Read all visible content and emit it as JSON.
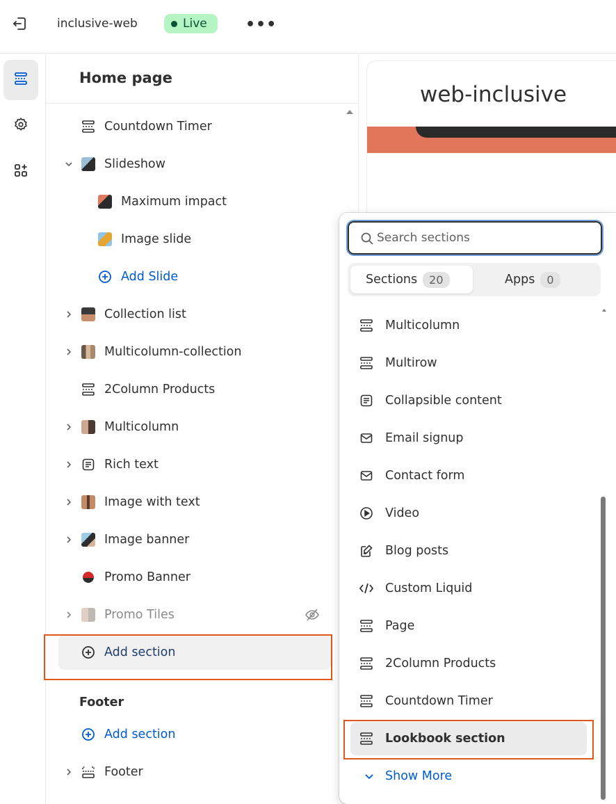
{
  "topbar": {
    "store_name": "inclusive-web",
    "status": "Live",
    "more": "•••",
    "exit_icon": "exit-icon"
  },
  "rail": {
    "items": [
      {
        "icon": "sections-icon",
        "active": true
      },
      {
        "icon": "settings-gear-icon",
        "active": false
      },
      {
        "icon": "apps-add-icon",
        "active": false
      }
    ]
  },
  "panel": {
    "title": "Home page",
    "sections": [
      {
        "label": "Countdown Timer",
        "icon": "section-icon"
      },
      {
        "label": "Slideshow",
        "icon": "image-thumb",
        "expanded": true
      },
      {
        "label": "Maximum impact",
        "icon": "image-thumb",
        "child": true
      },
      {
        "label": "Image slide",
        "icon": "image-thumb",
        "child": true
      },
      {
        "label": "Add Slide",
        "icon": "plus-circle-icon",
        "child": true,
        "link": true
      },
      {
        "label": "Collection list",
        "icon": "image-thumb"
      },
      {
        "label": "Multicolumn-collection",
        "icon": "image-thumb"
      },
      {
        "label": "2Column Products",
        "icon": "section-icon"
      },
      {
        "label": "Multicolumn",
        "icon": "image-thumb"
      },
      {
        "label": "Rich text",
        "icon": "text-block-icon"
      },
      {
        "label": "Image with text",
        "icon": "image-thumb"
      },
      {
        "label": "Image banner",
        "icon": "image-thumb"
      },
      {
        "label": "Promo Banner",
        "icon": "image-thumb"
      },
      {
        "label": "Promo Tiles",
        "icon": "image-thumb",
        "hidden": true
      }
    ],
    "add_section": "Add section",
    "footer_heading": "Footer",
    "footer_add_section": "Add section",
    "footer_item": "Footer"
  },
  "preview": {
    "title": "web-inclusive"
  },
  "picker": {
    "search_placeholder": "Search sections",
    "tabs": [
      {
        "label": "Sections",
        "count": "20"
      },
      {
        "label": "Apps",
        "count": "0"
      }
    ],
    "items": [
      {
        "label": "Multicolumn",
        "icon": "section-icon"
      },
      {
        "label": "Multirow",
        "icon": "section-icon"
      },
      {
        "label": "Collapsible content",
        "icon": "text-block-icon"
      },
      {
        "label": "Email signup",
        "icon": "email-icon"
      },
      {
        "label": "Contact form",
        "icon": "email-icon"
      },
      {
        "label": "Video",
        "icon": "play-circle-icon"
      },
      {
        "label": "Blog posts",
        "icon": "edit-note-icon"
      },
      {
        "label": "Custom Liquid",
        "icon": "code-icon"
      },
      {
        "label": "Page",
        "icon": "section-icon"
      },
      {
        "label": "2Column Products",
        "icon": "section-icon"
      },
      {
        "label": "Countdown Timer",
        "icon": "section-icon"
      },
      {
        "label": "Lookbook section",
        "icon": "section-icon",
        "active": true
      }
    ],
    "show_more": "Show More"
  },
  "colors": {
    "accent_link": "#005bd3",
    "live_badge_bg": "#b4f5c3",
    "highlight_border": "#e0571d"
  }
}
